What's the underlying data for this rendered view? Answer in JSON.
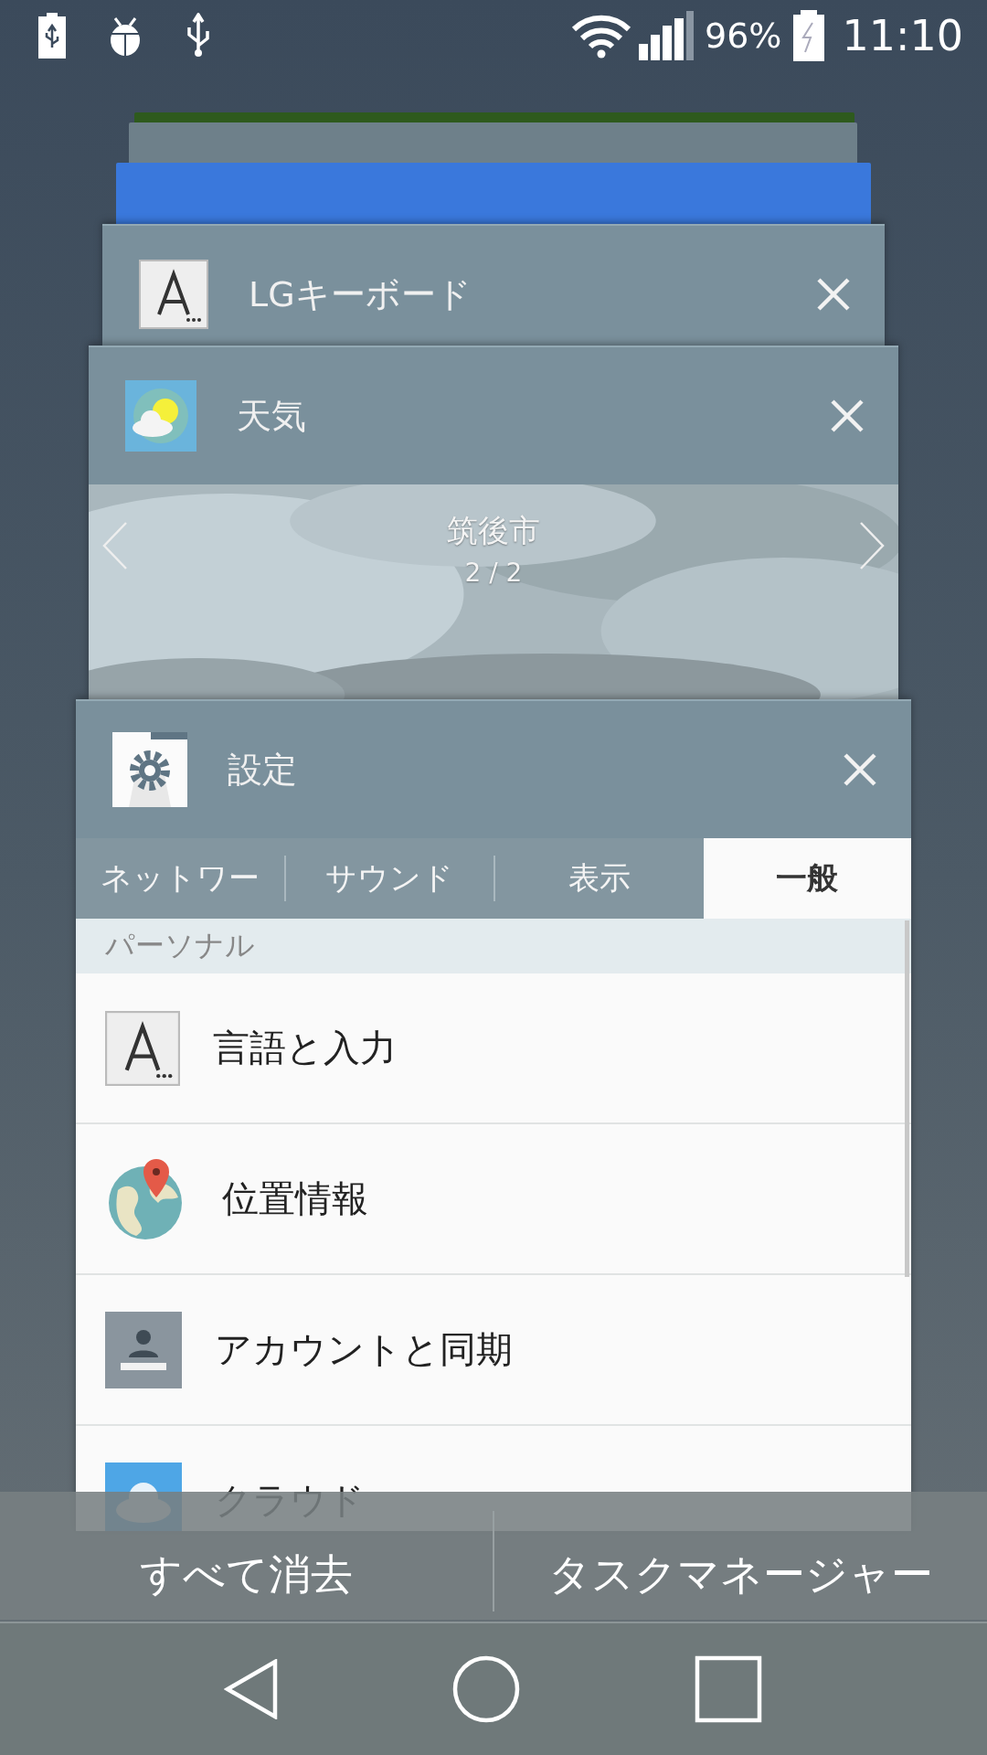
{
  "status_bar": {
    "battery_level": "96%",
    "time": "11:10"
  },
  "recent_apps": [
    {
      "kind": "plain",
      "title": "LGキーボード"
    },
    {
      "kind": "weather",
      "title": "天気",
      "city": "筑後市",
      "page": "2 / 2"
    },
    {
      "kind": "settings",
      "title": "設定",
      "tabs": [
        {
          "label": "ネットワー",
          "selected": false
        },
        {
          "label": "サウンド",
          "selected": false
        },
        {
          "label": "表示",
          "selected": false
        },
        {
          "label": "一般",
          "selected": true
        }
      ],
      "section": "パーソナル",
      "items": [
        "言語と入力",
        "位置情報",
        "アカウントと同期",
        "クラウド"
      ]
    }
  ],
  "actions": [
    "すべて消去",
    "タスクマネージャー"
  ]
}
